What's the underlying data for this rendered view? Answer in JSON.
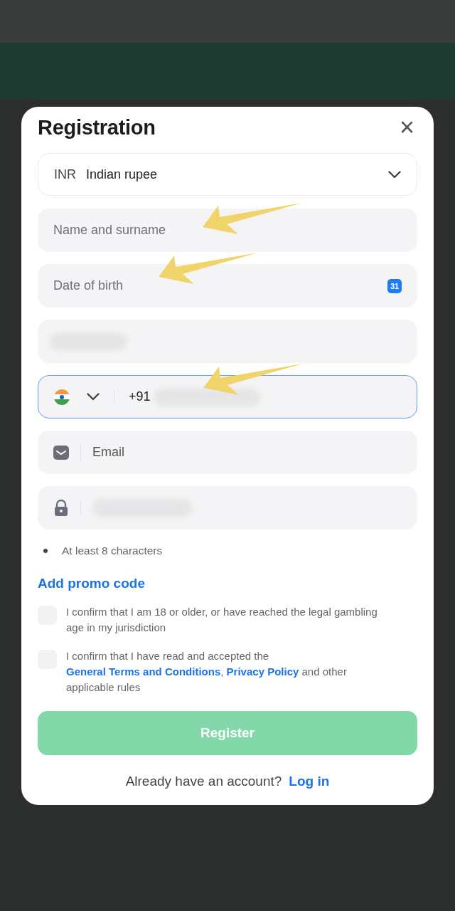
{
  "dialog": {
    "title": "Registration",
    "close": "×"
  },
  "currency": {
    "code": "INR",
    "name": "Indian rupee"
  },
  "fields": [
    {
      "kind": "text",
      "placeholder": "Name and surname",
      "arrow": true
    },
    {
      "kind": "date",
      "placeholder": "Date of birth",
      "calendar_day": "31",
      "arrow": true
    },
    {
      "kind": "redacted"
    },
    {
      "kind": "phone",
      "value": "+91",
      "focused": true,
      "arrow": true
    },
    {
      "kind": "email",
      "placeholder": "Email"
    },
    {
      "kind": "password"
    }
  ],
  "password_rules": [
    "At least 8 characters"
  ],
  "promo_link": "Add promo code",
  "consents": [
    {
      "checked": false,
      "parts": [
        {
          "text": "I confirm that I am 18 or older, or have reached the legal gambling age in my jurisdiction",
          "link": false
        }
      ]
    },
    {
      "checked": false,
      "parts": [
        {
          "text": "I confirm that I have read and accepted the ",
          "link": false
        },
        {
          "text": "General Terms and Conditions",
          "link": true
        },
        {
          "text": ", ",
          "link": false
        },
        {
          "text": "Privacy Policy",
          "link": true
        },
        {
          "text": " and other applicable rules",
          "link": false
        }
      ]
    }
  ],
  "register_button": {
    "label": "Register",
    "disabled": true
  },
  "footer": {
    "text": "Already have an account?",
    "link": "Log in"
  }
}
